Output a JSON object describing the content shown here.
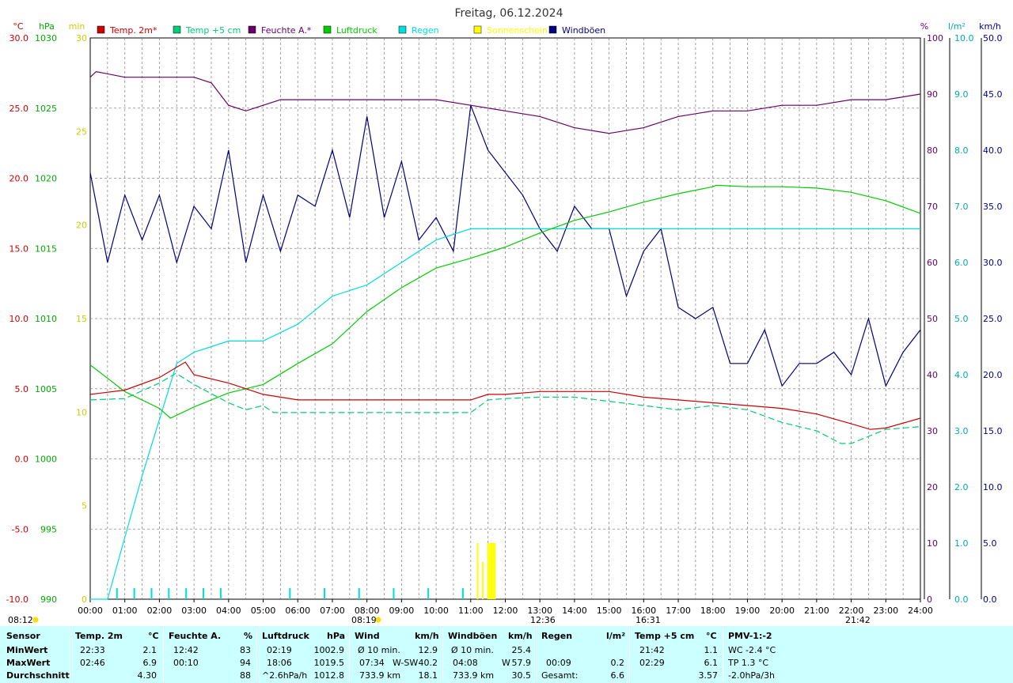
{
  "title": "Freitag, 06.12.2024",
  "colors": {
    "temp2m": "#cc0000",
    "temp5cm": "#00cc77",
    "humidity": "#660066",
    "pressure": "#00cc00",
    "rain": "#00dddd",
    "sunshine": "#ffff00",
    "gusts": "#000080",
    "stats_bg": "#ccffff"
  },
  "axis_units": {
    "temp": "°C",
    "pressure": "hPa",
    "sun_min": "min",
    "humidity": "%",
    "rain": "l/m²",
    "wind": "km/h"
  },
  "legend": [
    {
      "label": "Temp. 2m*",
      "color": "#cc0000"
    },
    {
      "label": "Temp +5 cm",
      "color": "#00cc77"
    },
    {
      "label": "Feuchte A.*",
      "color": "#660066"
    },
    {
      "label": "Luftdruck",
      "color": "#00cc00"
    },
    {
      "label": "Regen",
      "color": "#00dddd"
    },
    {
      "label": "Sonnenschein",
      "color": "#ffff00"
    },
    {
      "label": "Windböen",
      "color": "#000080"
    }
  ],
  "time_markers": {
    "sunrise_left": "08:12",
    "sunrise": "08:19",
    "noon": "12:36",
    "sunset": "16:31",
    "moon": "21:42"
  },
  "chart_data": {
    "type": "line",
    "title": "Freitag, 06.12.2024",
    "x_ticks": [
      "00:00",
      "01:00",
      "02:00",
      "03:00",
      "04:00",
      "05:00",
      "06:00",
      "07:00",
      "08:00",
      "09:00",
      "10:00",
      "11:00",
      "12:00",
      "13:00",
      "14:00",
      "15:00",
      "16:00",
      "17:00",
      "18:00",
      "19:00",
      "20:00",
      "21:00",
      "22:00",
      "23:00",
      "24:00"
    ],
    "axes": {
      "temp_c": {
        "ticks": [
          "30.0",
          "25.0",
          "20.0",
          "15.0",
          "10.0",
          "5.0",
          "0.0",
          "-5.0",
          "-10.0"
        ],
        "range": [
          -10,
          30
        ]
      },
      "pressure_hpa": {
        "ticks": [
          "1030",
          "1025",
          "1020",
          "1015",
          "1010",
          "1005",
          "1000",
          "995",
          "990"
        ],
        "range": [
          990,
          1030
        ]
      },
      "sun_min": {
        "ticks": [
          "30",
          "25",
          "20",
          "15",
          "10",
          "5",
          "0"
        ],
        "range": [
          0,
          30
        ]
      },
      "humidity_pct": {
        "ticks": [
          "100",
          "90",
          "80",
          "70",
          "60",
          "50",
          "40",
          "30",
          "20",
          "10",
          "0"
        ],
        "range": [
          0,
          100
        ]
      },
      "rain_lm2": {
        "ticks": [
          "10.0",
          "9.0",
          "8.0",
          "7.0",
          "6.0",
          "5.0",
          "4.0",
          "3.0",
          "2.0",
          "1.0",
          "0.0"
        ],
        "range": [
          0,
          10
        ]
      },
      "wind_kmh": {
        "ticks": [
          "50.0",
          "45.0",
          "40.0",
          "35.0",
          "30.0",
          "25.0",
          "20.0",
          "15.0",
          "10.0",
          "5.0",
          "0.0"
        ],
        "range": [
          0,
          50
        ]
      }
    },
    "series": [
      {
        "name": "Temp. 2m*",
        "axis": "temp_c",
        "x": [
          0,
          1,
          2,
          2.75,
          3,
          4,
          5,
          6,
          7,
          8,
          9,
          10,
          11,
          11.5,
          12,
          13,
          14,
          15,
          16,
          17,
          18,
          19,
          20,
          21,
          22,
          22.55,
          23,
          24
        ],
        "y": [
          4.6,
          4.9,
          5.8,
          6.9,
          6.0,
          5.4,
          4.6,
          4.2,
          4.2,
          4.2,
          4.2,
          4.2,
          4.2,
          4.6,
          4.6,
          4.8,
          4.8,
          4.8,
          4.4,
          4.2,
          4.0,
          3.8,
          3.6,
          3.2,
          2.5,
          2.1,
          2.2,
          2.9
        ]
      },
      {
        "name": "Temp +5 cm",
        "axis": "temp_c",
        "x": [
          0,
          1,
          2,
          2.48,
          3,
          4,
          4.5,
          5,
          5.3,
          6,
          7,
          8,
          9,
          10,
          11,
          11.5,
          12,
          13,
          14,
          15,
          16,
          17,
          18,
          19,
          20,
          21,
          21.7,
          22,
          23,
          24
        ],
        "y": [
          4.2,
          4.3,
          5.4,
          6.1,
          5.3,
          4.0,
          3.5,
          3.8,
          3.3,
          3.3,
          3.3,
          3.3,
          3.3,
          3.3,
          3.3,
          4.2,
          4.3,
          4.4,
          4.4,
          4.1,
          3.8,
          3.5,
          3.8,
          3.5,
          2.6,
          2.0,
          1.1,
          1.1,
          2.1,
          2.3
        ]
      },
      {
        "name": "Feuchte A.*",
        "axis": "humidity_pct",
        "x": [
          0,
          0.17,
          1,
          2,
          3,
          3.5,
          4,
          4.5,
          5,
          5.5,
          6,
          7,
          8,
          9,
          10,
          11,
          12,
          13,
          14,
          15,
          16,
          17,
          18,
          19,
          20,
          21,
          22,
          23,
          24
        ],
        "y": [
          93,
          94,
          93,
          93,
          93,
          92,
          88,
          87,
          88,
          89,
          89,
          89,
          89,
          89,
          89,
          88,
          87,
          86,
          84,
          83,
          84,
          86,
          87,
          87,
          88,
          88,
          89,
          89,
          90
        ]
      },
      {
        "name": "Luftdruck",
        "axis": "pressure_hpa",
        "x": [
          0,
          1,
          2,
          2.32,
          3,
          4,
          5,
          6,
          7,
          8,
          9,
          10,
          11,
          12,
          13,
          14,
          15,
          16,
          17,
          18,
          18.1,
          19,
          20,
          21,
          22,
          23,
          24
        ],
        "y": [
          1006.7,
          1004.8,
          1003.6,
          1002.9,
          1003.7,
          1004.7,
          1005.3,
          1006.8,
          1008.2,
          1010.5,
          1012.2,
          1013.6,
          1014.3,
          1015.1,
          1016.1,
          1017.0,
          1017.6,
          1018.3,
          1018.9,
          1019.4,
          1019.5,
          1019.4,
          1019.4,
          1019.3,
          1019.0,
          1018.4,
          1017.5
        ]
      },
      {
        "name": "Regen",
        "axis": "rain_lm2",
        "x": [
          0,
          0.5,
          1,
          1.5,
          2,
          2.5,
          3,
          3.5,
          4,
          4.5,
          5,
          6,
          7,
          8,
          9,
          10,
          11,
          12,
          13,
          14,
          15,
          16,
          17,
          18,
          19,
          20,
          21,
          22,
          23,
          24
        ],
        "y": [
          0,
          0,
          1.1,
          2.2,
          3.2,
          4.2,
          4.4,
          4.5,
          4.6,
          4.6,
          4.6,
          4.9,
          5.4,
          5.6,
          6.0,
          6.4,
          6.6,
          6.6,
          6.6,
          6.6,
          6.6,
          6.6,
          6.6,
          6.6,
          6.6,
          6.6,
          6.6,
          6.6,
          6.6,
          6.6
        ]
      },
      {
        "name": "Windböen",
        "axis": "wind_kmh",
        "x": [
          0,
          0.5,
          1,
          1.5,
          2,
          2.5,
          3,
          3.5,
          4,
          4.5,
          5,
          5.5,
          6,
          6.5,
          7,
          7.5,
          8,
          8.5,
          9,
          9.5,
          10,
          10.5,
          11,
          11.5,
          12,
          12.5,
          13,
          13.5,
          14,
          14.5,
          15,
          15.5,
          16,
          16.5,
          17,
          17.5,
          18,
          18.5,
          19,
          19.5,
          20,
          20.5,
          21,
          21.5,
          22,
          22.5,
          23,
          23.5,
          24
        ],
        "y": [
          38,
          30,
          36,
          32,
          36,
          30,
          35,
          33,
          40,
          30,
          36,
          31,
          36,
          35,
          40,
          34,
          43,
          34,
          39,
          32,
          34,
          31,
          44,
          40,
          38,
          36,
          33,
          31,
          35,
          33,
          33,
          27,
          31,
          33,
          26,
          25,
          26,
          21,
          21,
          24,
          19,
          21,
          21,
          22,
          20,
          25,
          19,
          22,
          24
        ]
      },
      {
        "name": "Sonnenschein",
        "axis": "sun_min",
        "x": [
          11.2,
          11.35,
          11.5,
          11.55,
          11.6,
          11.65,
          11.7
        ],
        "y": [
          3,
          2,
          3,
          3,
          3,
          3,
          3
        ]
      }
    ]
  },
  "stats": {
    "sensor": {
      "header": "Sensor",
      "rows": [
        "MinWert",
        "MaxWert",
        "Durchschnitt"
      ]
    },
    "temp2m": {
      "header": "Temp. 2m",
      "unit": "°C",
      "min_time": "22:33",
      "min_val": "2.1",
      "max_time": "02:46",
      "max_val": "6.9",
      "avg_val": "4.30"
    },
    "humidity": {
      "header": "Feuchte A.",
      "unit": "%",
      "min_time": "12:42",
      "min_val": "83",
      "max_time": "00:10",
      "max_val": "94",
      "avg_val": "88"
    },
    "pressure": {
      "header": "Luftdruck",
      "unit": "hPa",
      "min_time": "02:19",
      "min_val": "1002.9",
      "max_time": "18:06",
      "max_val": "1019.5",
      "trend": "^2.6hPa/h",
      "avg_val": "1012.8"
    },
    "wind": {
      "header": "Wind",
      "unit": "km/h",
      "r1_label": "Ø 10 min.",
      "r1_val": "12.9",
      "r2_time": "07:34",
      "r2_dir": "W-SW",
      "r2_val": "40.2",
      "r3_dist": "733.9 km",
      "r3_val": "18.1"
    },
    "gusts": {
      "header": "Windböen",
      "unit": "km/h",
      "r1_label": "Ø 10 min.",
      "r1_val": "25.4",
      "r2_time": "04:08",
      "r2_dir": "W",
      "r2_val": "57.9",
      "r3_dist": "733.9 km",
      "r3_val": "30.5"
    },
    "rain": {
      "header": "Regen",
      "unit": "l/m²",
      "r2_time": "00:09",
      "r2_val": "0.2",
      "r3_label": "Gesamt:",
      "r3_val": "6.6"
    },
    "temp5cm": {
      "header": "Temp +5 cm",
      "unit": "°C",
      "min_time": "21:42",
      "min_val": "1.1",
      "max_time": "02:29",
      "max_val": "6.1",
      "avg_val": "3.57"
    },
    "pmv": {
      "header": "PMV-1:-2",
      "r1": "WC -2.4 °C",
      "r2": "TP 1.3 °C",
      "r3": "-2.0hPa/3h"
    }
  }
}
